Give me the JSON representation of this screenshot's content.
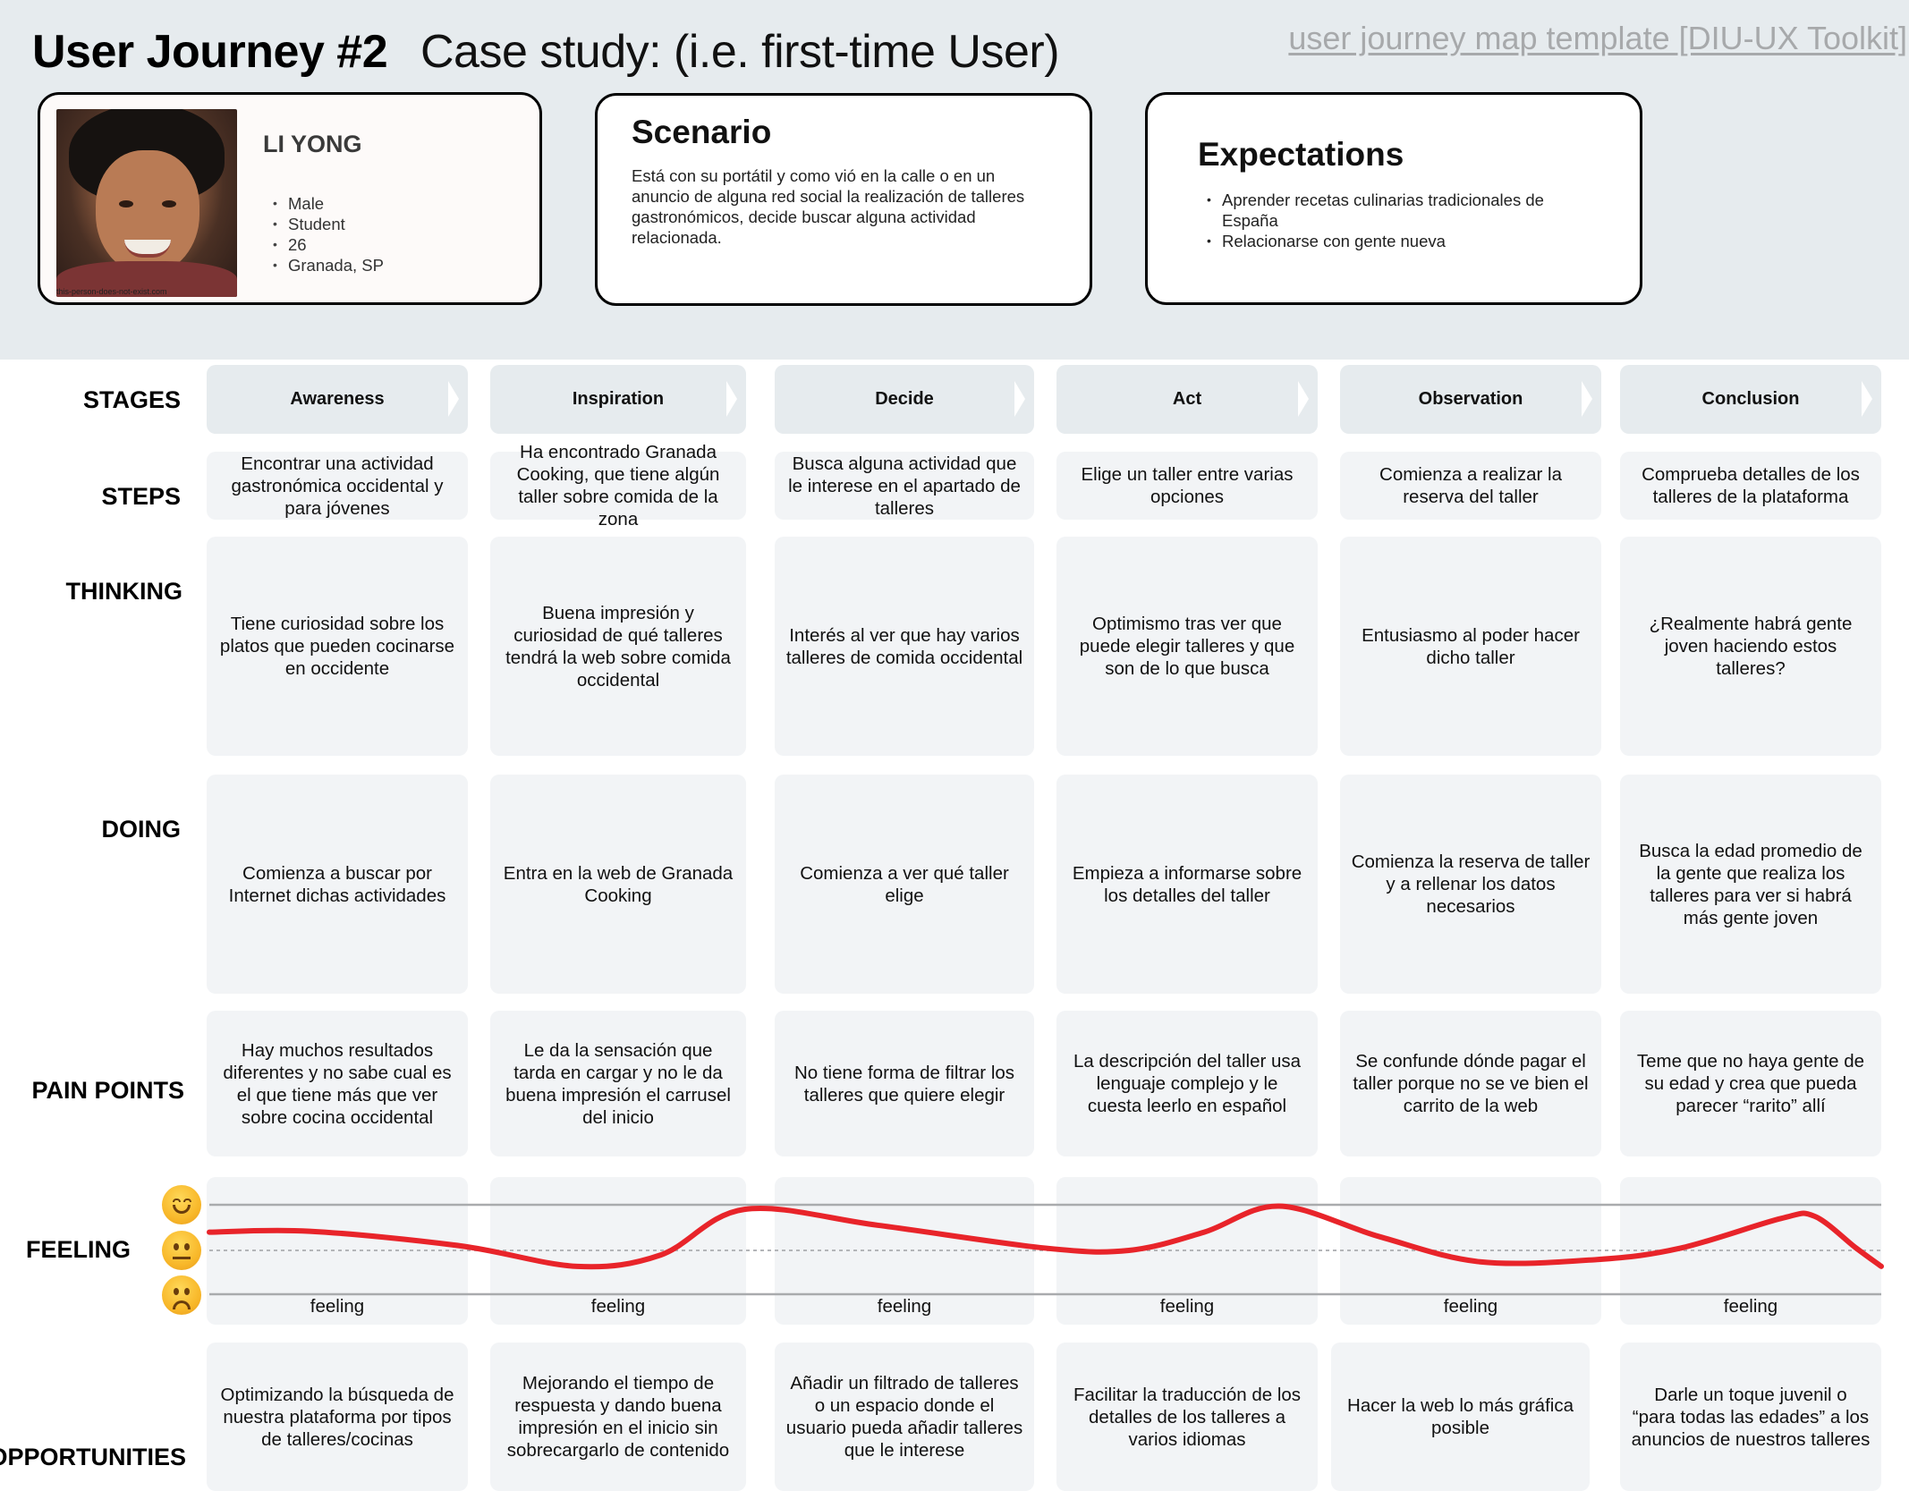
{
  "header": {
    "title": "User Journey #2",
    "subtitle": "Case study: (i.e. first-time User)",
    "template_link": "user journey map template [DIU-UX Toolkit]"
  },
  "persona": {
    "name": "LI YONG",
    "photo_credit": "this-person-does-not-exist.com",
    "attributes": [
      "Male",
      "Student",
      "26",
      "Granada, SP"
    ]
  },
  "scenario": {
    "heading": "Scenario",
    "text": "Está con su portátil y como vió en la calle o en un anuncio de alguna red social la realización de talleres gastronómicos, decide buscar alguna actividad relacionada."
  },
  "expectations": {
    "heading": "Expectations",
    "items": [
      "Aprender recetas culinarias tradicionales de España",
      "Relacionarse con gente nueva"
    ]
  },
  "row_labels": {
    "stages": "STAGES",
    "steps": "STEPS",
    "thinking": "THINKING",
    "doing": "DOING",
    "pain_points": "PAIN POINTS",
    "feeling": "FEELING",
    "opportunities": "OPPORTUNITIES"
  },
  "stages": [
    "Awareness",
    "Inspiration",
    "Decide",
    "Act",
    "Observation",
    "Conclusion"
  ],
  "steps": [
    "Encontrar una actividad gastronómica occidental y para jóvenes",
    "Ha encontrado Granada Cooking, que tiene algún taller sobre comida de la zona",
    "Busca alguna actividad que le interese en el apartado de talleres",
    "Elige un taller entre varias opciones",
    "Comienza a realizar la reserva del taller",
    "Comprueba detalles de los talleres de la plataforma"
  ],
  "thinking": [
    "Tiene curiosidad sobre los platos que pueden cocinarse en occidente",
    "Buena impresión y curiosidad de qué talleres tendrá la web sobre comida occidental",
    "Interés al ver que hay varios talleres de comida occidental",
    "Optimismo tras ver que puede elegir talleres y que son de lo que busca",
    "Entusiasmo al poder hacer dicho taller",
    "¿Realmente habrá gente joven haciendo estos talleres?"
  ],
  "doing": [
    "Comienza a buscar por Internet dichas actividades",
    "Entra en la web de Granada Cooking",
    "Comienza a ver qué taller elige",
    "Empieza a informarse sobre los detalles del taller",
    "Comienza la reserva de taller y a rellenar los datos necesarios",
    "Busca la edad promedio de la gente que realiza los talleres para ver si habrá más gente joven"
  ],
  "pain_points": [
    "Hay muchos resultados diferentes y no sabe cual es el que tiene más que ver sobre cocina occidental",
    "Le da la sensación que tarda en cargar y no le da buena impresión el carrusel del inicio",
    "No tiene forma de filtrar los talleres que quiere elegir",
    "La descripción del taller usa lenguaje complejo y le cuesta leerlo en español",
    "Se confunde dónde pagar el taller porque no se ve bien el carrito de la web",
    "Teme que no haya gente de su edad y crea que pueda parecer “rarito” allí"
  ],
  "feeling": {
    "cell_label": "feeling",
    "scale": [
      "happy",
      "neutral",
      "sad"
    ],
    "line_color": "#e8242a",
    "curve": [
      {
        "pos": 0.0,
        "level": 0.4
      },
      {
        "pos": 0.06,
        "level": 0.42
      },
      {
        "pos": 0.15,
        "level": 0.1
      },
      {
        "pos": 0.22,
        "level": -0.35
      },
      {
        "pos": 0.27,
        "level": -0.1
      },
      {
        "pos": 0.32,
        "level": 0.9
      },
      {
        "pos": 0.4,
        "level": 0.55
      },
      {
        "pos": 0.5,
        "level": 0.05
      },
      {
        "pos": 0.55,
        "level": 0.0
      },
      {
        "pos": 0.595,
        "level": 0.4
      },
      {
        "pos": 0.64,
        "level": 0.97
      },
      {
        "pos": 0.7,
        "level": 0.3
      },
      {
        "pos": 0.76,
        "level": -0.25
      },
      {
        "pos": 0.83,
        "level": -0.2
      },
      {
        "pos": 0.88,
        "level": 0.05
      },
      {
        "pos": 0.94,
        "level": 0.7
      },
      {
        "pos": 0.96,
        "level": 0.75
      },
      {
        "pos": 0.985,
        "level": 0.05
      },
      {
        "pos": 1.0,
        "level": -0.35
      }
    ]
  },
  "opportunities": [
    "Optimizando la búsqueda de nuestra plataforma por tipos de talleres/cocinas",
    "Mejorando el tiempo de respuesta y dando buena impresión en el inicio sin sobrecargarlo de contenido",
    "Añadir un filtrado de talleres o un espacio donde el usuario pueda añadir talleres que le interese",
    "Facilitar la traducción de los detalles de los talleres a varios idiomas",
    "Hacer la web lo más gráfica posible",
    "Darle un toque juvenil o “para todas las edades” a los anuncios de nuestros talleres"
  ]
}
